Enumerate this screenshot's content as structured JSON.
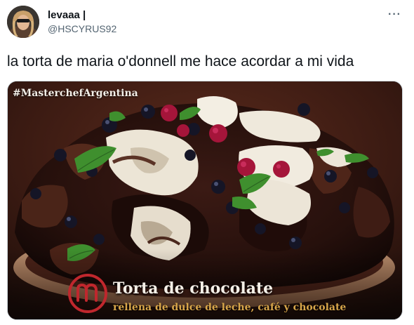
{
  "tweet": {
    "display_name": "levaaa |",
    "handle": "@HSCYRUS92",
    "more_label": "···",
    "text": "la torta de maria o'donnell me hace acordar a mi vida"
  },
  "media": {
    "hashtag": "#MasterchefArgentina",
    "caption_title": "Torta de chocolate",
    "caption_subtitle": "rellena de dulce de leche, café y chocolate",
    "logo_letter": "M",
    "accent_gold": "#d8a64a",
    "logo_red": "#c0272d"
  }
}
